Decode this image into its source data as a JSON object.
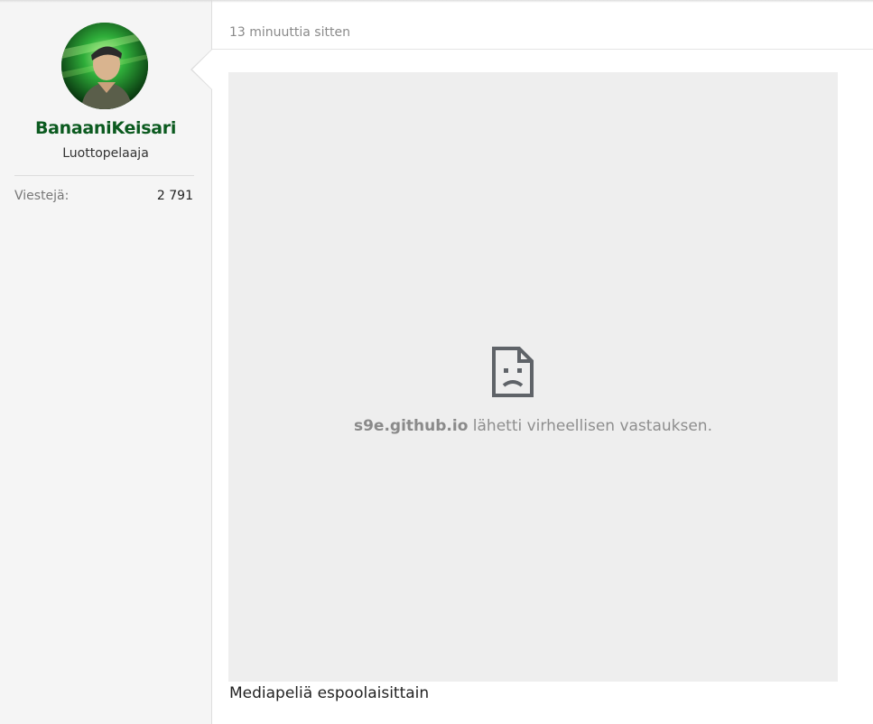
{
  "user": {
    "username": "BanaaniKeisari",
    "title": "Luottopelaaja",
    "stats": [
      {
        "label": "Viestejä:",
        "value": "2 791"
      }
    ]
  },
  "post": {
    "timestamp": "13 minuuttia sitten",
    "embed": {
      "icon": "broken-page-icon",
      "error_host": "s9e.github.io",
      "error_text": " lähetti virheellisen vastauksen."
    },
    "caption": "Mediapeliä espoolaisittain"
  },
  "colors": {
    "username": "#0b5a1f",
    "sidebar_bg": "#f5f5f5",
    "embed_bg": "#eeeeee"
  }
}
